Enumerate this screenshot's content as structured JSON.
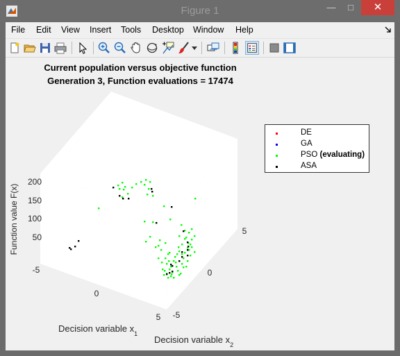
{
  "window": {
    "title": "Figure 1",
    "minimize_icon": "minimize-icon",
    "maximize_icon": "maximize-icon",
    "close_label": "✕"
  },
  "menu": [
    "File",
    "Edit",
    "View",
    "Insert",
    "Tools",
    "Desktop",
    "Window",
    "Help"
  ],
  "toolbar": {
    "icons": [
      "new-figure-icon",
      "open-file-icon",
      "save-icon",
      "print-icon",
      "pointer-icon",
      "zoom-in-icon",
      "zoom-out-icon",
      "pan-icon",
      "rotate-3d-icon",
      "data-cursor-icon",
      "brush-icon",
      "brush-dropdown-icon",
      "link-plot-icon",
      "colorbar-icon",
      "legend-icon",
      "hide-plot-tools-icon",
      "show-plot-tools-icon"
    ],
    "active": "legend-icon"
  },
  "chart_data": {
    "type": "scatter",
    "title": [
      "Current population versus objective function",
      "Generation 3, Function evaluations = 17474"
    ],
    "zlabel": "Function value F(x)",
    "xlabel": "Decision variable x",
    "xlabel_sub": "1",
    "ylabel": "Decision variable x",
    "ylabel_sub": "2",
    "zticks": [
      "50",
      "100",
      "150",
      "200"
    ],
    "x1ticks": [
      "-5",
      "0",
      "5"
    ],
    "x2ticks": [
      "5",
      "0",
      "-5"
    ],
    "legend": [
      {
        "name": "DE",
        "color": "#ff0000"
      },
      {
        "name": "GA",
        "color": "#0000ff"
      },
      {
        "name": "PSO",
        "suffix": " (evaluating)",
        "color": "#00ff00"
      },
      {
        "name": "ASA",
        "color": "#000000"
      }
    ],
    "series": [
      {
        "name": "PSO",
        "color": "#00ff00",
        "projected": [
          [
            142,
            300
          ],
          [
            170,
            267
          ],
          [
            172,
            272
          ],
          [
            176,
            284
          ],
          [
            178,
            273
          ],
          [
            180,
            269
          ],
          [
            176,
            263
          ],
          [
            184,
            279
          ],
          [
            190,
            270
          ],
          [
            196,
            265
          ],
          [
            203,
            262
          ],
          [
            210,
            259
          ],
          [
            216,
            262
          ],
          [
            208,
            266
          ],
          [
            214,
            272
          ],
          [
            212,
            280
          ],
          [
            220,
            282
          ],
          [
            236,
            297
          ],
          [
            281,
            286
          ],
          [
            208,
            319
          ],
          [
            220,
            320
          ],
          [
            245,
            316
          ],
          [
            210,
            348
          ],
          [
            216,
            341
          ],
          [
            224,
            356
          ],
          [
            230,
            346
          ],
          [
            238,
            350
          ],
          [
            244,
            364
          ],
          [
            250,
            376
          ],
          [
            254,
            384
          ],
          [
            246,
            398
          ],
          [
            258,
            362
          ],
          [
            262,
            352
          ],
          [
            268,
            342
          ],
          [
            272,
            335
          ],
          [
            266,
            332
          ],
          [
            261,
            324
          ],
          [
            270,
            357
          ],
          [
            274,
            368
          ],
          [
            276,
            345
          ],
          [
            264,
            372
          ],
          [
            256,
            390
          ],
          [
            248,
            392
          ],
          [
            244,
            388
          ],
          [
            240,
            394
          ],
          [
            242,
            400
          ],
          [
            250,
            400
          ],
          [
            236,
            396
          ],
          [
            240,
            380
          ],
          [
            252,
            370
          ],
          [
            257,
            356
          ],
          [
            262,
            380
          ],
          [
            266,
            364
          ],
          [
            260,
            394
          ],
          [
            253,
            378
          ],
          [
            246,
            384
          ],
          [
            234,
            388
          ],
          [
            228,
            372
          ],
          [
            232,
            360
          ],
          [
            238,
            372
          ],
          [
            242,
            366
          ],
          [
            228,
            354
          ],
          [
            270,
            376
          ],
          [
            262,
            366
          ],
          [
            268,
            384
          ],
          [
            272,
            360
          ],
          [
            274,
            352
          ],
          [
            280,
            340
          ],
          [
            276,
            330
          ],
          [
            266,
            344
          ],
          [
            258,
            340
          ],
          [
            264,
            385
          ],
          [
            258,
            396
          ],
          [
            247,
            395
          ],
          [
            237,
            390
          ],
          [
            243,
            376
          ],
          [
            233,
            378
          ],
          [
            255,
            366
          ],
          [
            271,
            350
          ],
          [
            280,
            363
          ],
          [
            276,
            356
          ]
        ]
      },
      {
        "name": "ASA",
        "color": "#000000",
        "projected": [
          [
            100,
            357
          ],
          [
            102,
            359
          ],
          [
            108,
            355
          ],
          [
            113,
            347
          ],
          [
            163,
            270
          ],
          [
            172,
            282
          ],
          [
            177,
            286
          ],
          [
            185,
            286
          ],
          [
            218,
            272
          ],
          [
            219,
            276
          ],
          [
            247,
            298
          ],
          [
            225,
            321
          ],
          [
            264,
            333
          ],
          [
            270,
            349
          ],
          [
            271,
            355
          ],
          [
            270,
            360
          ],
          [
            262,
            363
          ],
          [
            258,
            376
          ],
          [
            246,
            381
          ],
          [
            248,
            383
          ],
          [
            248,
            391
          ],
          [
            244,
            393
          ],
          [
            240,
            395
          ],
          [
            270,
            368
          ],
          [
            262,
            370
          ]
        ]
      }
    ]
  }
}
